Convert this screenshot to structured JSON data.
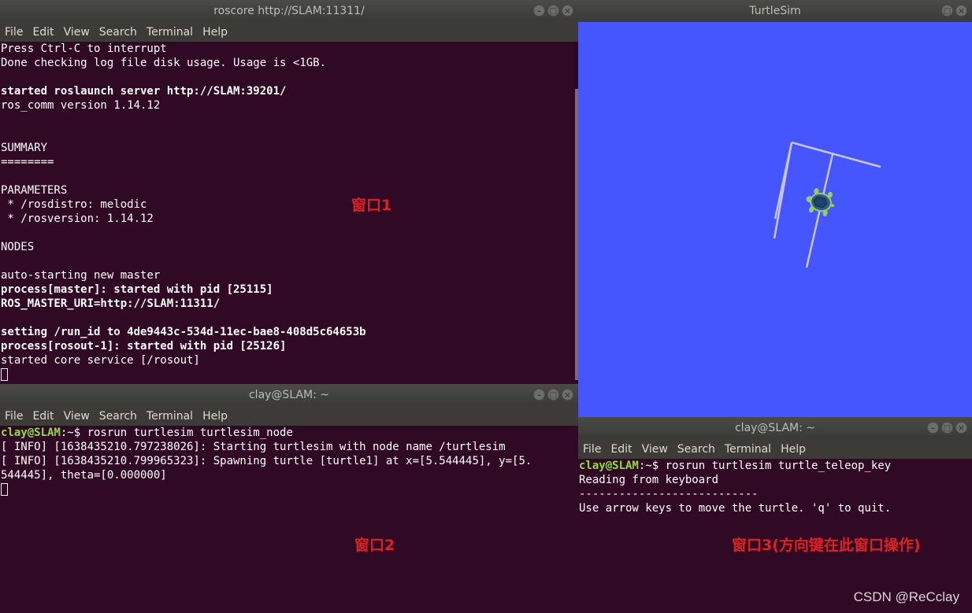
{
  "menus": [
    "File",
    "Edit",
    "View",
    "Search",
    "Terminal",
    "Help"
  ],
  "window1": {
    "title": "roscore http://SLAM:11311/",
    "lines": [
      {
        "text": "Press Ctrl-C to interrupt",
        "bold": false
      },
      {
        "text": "Done checking log file disk usage. Usage is <1GB.",
        "bold": false
      },
      {
        "text": "",
        "bold": false
      },
      {
        "text": "started roslaunch server http://SLAM:39201/",
        "bold": true
      },
      {
        "text": "ros_comm version 1.14.12",
        "bold": false
      },
      {
        "text": "",
        "bold": false
      },
      {
        "text": "",
        "bold": false
      },
      {
        "text": "SUMMARY",
        "bold": false
      },
      {
        "text": "========",
        "bold": false
      },
      {
        "text": "",
        "bold": false
      },
      {
        "text": "PARAMETERS",
        "bold": false
      },
      {
        "text": " * /rosdistro: melodic",
        "bold": false
      },
      {
        "text": " * /rosversion: 1.14.12",
        "bold": false
      },
      {
        "text": "",
        "bold": false
      },
      {
        "text": "NODES",
        "bold": false
      },
      {
        "text": "",
        "bold": false
      },
      {
        "text": "auto-starting new master",
        "bold": false
      },
      {
        "text": "process[master]: started with pid [25115]",
        "bold": true
      },
      {
        "text": "ROS_MASTER_URI=http://SLAM:11311/",
        "bold": true
      },
      {
        "text": "",
        "bold": false
      },
      {
        "text": "setting /run_id to 4de9443c-534d-11ec-bae8-408d5c64653b",
        "bold": true
      },
      {
        "text": "process[rosout-1]: started with pid [25126]",
        "bold": true
      },
      {
        "text": "started core service [/rosout]",
        "bold": false
      }
    ],
    "annotation": "窗口1"
  },
  "window2": {
    "title": "clay@SLAM: ~",
    "prompt_user": "clay@SLAM",
    "prompt_path": ":~$ ",
    "command": "rosrun turtlesim turtlesim_node",
    "lines": [
      "[ INFO] [1638435210.797238026]: Starting turtlesim with node name /turtlesim",
      "[ INFO] [1638435210.799965323]: Spawning turtle [turtle1] at x=[5.544445], y=[5.",
      "544445], theta=[0.000000]"
    ],
    "annotation": "窗口2"
  },
  "turtlesim": {
    "title": "TurtleSim",
    "background": "#4556ff"
  },
  "window3": {
    "title": "clay@SLAM: ~",
    "prompt_user": "clay@SLAM",
    "prompt_path": ":~$ ",
    "command": "rosrun turtlesim turtle_teleop_key",
    "lines": [
      "Reading from keyboard",
      "---------------------------",
      "Use arrow keys to move the turtle. 'q' to quit."
    ],
    "annotation": "窗口3(方向键在此窗口操作)"
  },
  "watermark": "CSDN @ReCclay"
}
